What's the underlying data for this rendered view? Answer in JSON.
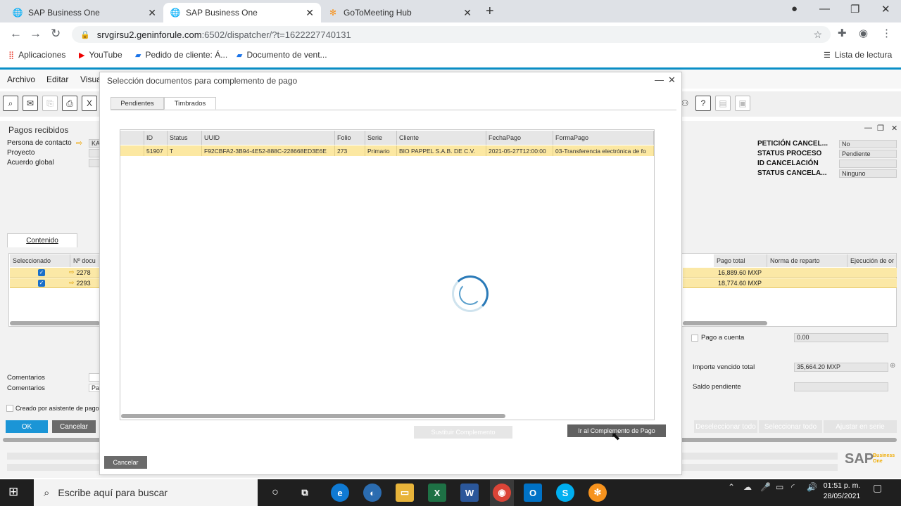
{
  "browser": {
    "tabs": [
      {
        "title": "SAP Business One",
        "icon": "globe-icon"
      },
      {
        "title": "SAP Business One",
        "icon": "globe-icon"
      },
      {
        "title": "GoToMeeting Hub",
        "icon": "gotomeeting-icon"
      }
    ],
    "url_host": "srvgirsu2.geninforule.com",
    "url_rest": ":6502/dispatcher/?t=1622227740131",
    "bookmarks": [
      "Aplicaciones",
      "YouTube",
      "Pedido de cliente: Á...",
      "Documento de vent..."
    ],
    "reading_list": "Lista de lectura"
  },
  "sap": {
    "menu": [
      "Archivo",
      "Editar",
      "Visua"
    ],
    "form_title": "Pagos recibidos",
    "left_labels": [
      "Persona de contacto",
      "Proyecto",
      "Acuerdo global"
    ],
    "left_value_partial": "KA",
    "right_labels": [
      "PETICIÓN CANCEL...",
      "STATUS PROCESO",
      "ID CANCELACIÓN",
      "STATUS CANCELA..."
    ],
    "right_values": [
      "No",
      "Pendiente",
      "",
      "Ninguno"
    ],
    "content_tab": "Contenido",
    "grid_headers_left": [
      "Seleccionado",
      "Nº docu"
    ],
    "grid_headers_right": [
      "Pago total",
      "Norma de reparto",
      "Ejecución de or"
    ],
    "grid_rows": [
      {
        "doc": "2278",
        "pago_total": "16,889.60 MXP"
      },
      {
        "doc": "2293",
        "pago_total": "18,774.60 MXP"
      }
    ],
    "pago_a_cuenta_label": "Pago a cuenta",
    "pago_a_cuenta_value": "0.00",
    "importe_vencido_label": "Importe vencido total",
    "importe_vencido_value": "35,664.20 MXP",
    "saldo_pendiente_label": "Saldo pendiente",
    "comentarios_label_1": "Comentarios",
    "comentarios_label_2": "Comentarios",
    "comentarios_value_partial": "Pa",
    "creado_label": "Creado por asistente de pago",
    "ok_label": "OK",
    "cancelar_label": "Cancelar",
    "bottom_buttons": [
      "Deseleccionar todo",
      "Seleccionar todo",
      "Ajustar en serie"
    ],
    "logo_text": "SAP",
    "logo_sub": "Business One",
    "colors": {
      "accent_blue": "#0a8fc7",
      "row_yellow": "#fbe8a6"
    }
  },
  "modal": {
    "title": "Selección documentos para complemento de pago",
    "tabs": [
      "Pendientes",
      "Timbrados"
    ],
    "active_tab": "Timbrados",
    "columns": [
      "ID",
      "Status",
      "UUID",
      "Folio",
      "Serie",
      "Cliente",
      "FechaPago",
      "FormaPago"
    ],
    "rows": [
      {
        "ID": "51907",
        "Status": "T",
        "UUID": "F92CBFA2-3B94-4E52-888C-228668ED3E6E",
        "Folio": "273",
        "Serie": "Primario",
        "Cliente": "BIO PAPPEL S.A.B. DE C.V.",
        "FechaPago": "2021-05-27T12:00:00",
        "FormaPago": "03-Transferencia electrónica de fo"
      }
    ],
    "sustituir_label": "Sustituir Complemento",
    "ir_label": "Ir al Complemento de Pago",
    "cancelar_label": "Cancelar",
    "loading": true
  },
  "taskbar": {
    "search_placeholder": "Escribe aquí para buscar",
    "time": "01:51 p. m.",
    "date": "28/05/2021"
  }
}
